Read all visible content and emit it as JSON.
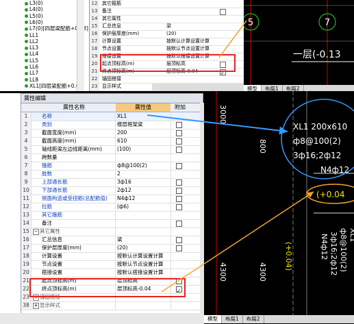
{
  "tree": {
    "items": [
      "L3(0)",
      "L4(0)",
      "L5(0)",
      "L6(0)",
      "L7(0)[四层梁配筋+0.08]",
      "LL1",
      "LL2",
      "LL3",
      "LL4",
      "LL5",
      "LL6",
      "LL7",
      "LL8",
      "XL1[四层梁配筋+0.04]"
    ]
  },
  "mini": {
    "rows": [
      {
        "num": "12",
        "name": "其它箍筋",
        "value": "",
        "check": false
      },
      {
        "num": "13",
        "name": "备注",
        "value": "",
        "check": false
      },
      {
        "num": "14",
        "name": "其它属性",
        "value": "",
        "check": false
      },
      {
        "num": "15",
        "name": "汇总信息",
        "value": "梁",
        "check": false
      },
      {
        "num": "16",
        "name": "保护层厚度(mm)",
        "value": "(20)",
        "check": false
      },
      {
        "num": "17",
        "name": "计算设置",
        "value": "按默认计算设置计算",
        "check": false
      },
      {
        "num": "18",
        "name": "节点设置",
        "value": "按默认节点设置计算",
        "check": false
      },
      {
        "num": "19",
        "name": "搭接设置",
        "value": "按默认搭接设置计算",
        "check": false
      },
      {
        "num": "20",
        "name": "起点顶标高(m)",
        "value": "层顶标高",
        "check": false
      },
      {
        "num": "21",
        "name": "终点顶标高(m)",
        "value": "层顶标高-0.04",
        "check": true
      },
      {
        "num": "22",
        "name": "锚固搭接",
        "value": "",
        "check": false
      },
      {
        "num": "23",
        "name": "显示样式",
        "value": "",
        "check": false
      }
    ]
  },
  "cad_top": {
    "axis_left": "5",
    "axis_right": "7",
    "floor_label": "一层(-0.13",
    "tabs": [
      "模型",
      "布局1",
      "布局2"
    ]
  },
  "editor": {
    "panel_title": "属性编辑",
    "col_name": "属性名称",
    "col_value": "属性值",
    "col_append": "附加",
    "rows": [
      {
        "num": "1",
        "name": "名称",
        "value": "XL1",
        "blue": true,
        "check": false,
        "sel": true
      },
      {
        "num": "2",
        "name": "类别",
        "value": "楼层框架梁",
        "blue": true,
        "check": true
      },
      {
        "num": "3",
        "name": "截面宽度(mm)",
        "value": "200",
        "blue": false,
        "check": true
      },
      {
        "num": "4",
        "name": "截面高度(mm)",
        "value": "610",
        "blue": false,
        "check": true
      },
      {
        "num": "5",
        "name": "轴线距梁左边线距离(mm)",
        "value": "(100)",
        "blue": false,
        "check": true
      },
      {
        "num": "6",
        "name": "跨数量",
        "value": "",
        "blue": false,
        "check": false
      },
      {
        "num": "7",
        "name": "箍筋",
        "value": "ф8@100(2)",
        "blue": true,
        "check": true
      },
      {
        "num": "8",
        "name": "肢数",
        "value": "2",
        "blue": true,
        "check": false
      },
      {
        "num": "9",
        "name": "上部通长筋",
        "value": "3ф16",
        "blue": true,
        "check": true
      },
      {
        "num": "10",
        "name": "下部通长筋",
        "value": "2ф12",
        "blue": true,
        "check": true
      },
      {
        "num": "11",
        "name": "侧面构造或受扭筋(总配筋值)",
        "value": "N4ф12",
        "blue": true,
        "check": true
      },
      {
        "num": "12",
        "name": "拉筋",
        "value": "(ф6)",
        "blue": true,
        "check": true
      },
      {
        "num": "13",
        "name": "其它箍筋",
        "value": "",
        "blue": true,
        "check": false
      },
      {
        "num": "14",
        "name": "备注",
        "value": "",
        "blue": false,
        "check": true
      },
      {
        "num": "15",
        "name": "其它属性",
        "value": "",
        "blue": false,
        "check": false,
        "section": true
      },
      {
        "num": "16",
        "name": "汇总信息",
        "value": "梁",
        "blue": false,
        "check": true
      },
      {
        "num": "17",
        "name": "保护层厚度(mm)",
        "value": "(20)",
        "blue": false,
        "check": true
      },
      {
        "num": "18",
        "name": "计算设置",
        "value": "按默认计算设置计算",
        "blue": false,
        "check": false
      },
      {
        "num": "19",
        "name": "节点设置",
        "value": "按默认节点设置计算",
        "blue": false,
        "check": false
      },
      {
        "num": "20",
        "name": "搭接设置",
        "value": "按默认搭接设置计算",
        "blue": false,
        "check": false
      },
      {
        "num": "21",
        "name": "起点顶标高(m)",
        "value": "层顶标高",
        "blue": false,
        "check": true
      },
      {
        "num": "22",
        "name": "终点顶标高(m)",
        "value": "层顶标高-0.04",
        "blue": false,
        "check": true,
        "checked": true
      },
      {
        "num": "23",
        "name": "锚固搭接",
        "value": "",
        "blue": false,
        "check": false,
        "section": true
      },
      {
        "num": "38",
        "name": "显示样式",
        "value": "",
        "blue": false,
        "check": false,
        "section": true
      }
    ]
  },
  "cad": {
    "dim_top": "3000",
    "dim_mid": "800",
    "dim_bottom_left": "4300",
    "dim_bottom_right": "4300",
    "annot_lines": [
      "XL1 200x610",
      "ф8@100(2)",
      "3ф16;2ф12",
      "N4ф12"
    ],
    "elevation": "(+0.04",
    "lower_annot": [
      "ф8@100(2)",
      "3ф16;2ф12",
      "N4ф12"
    ],
    "lower_elev": "(+0.04)",
    "lower_side": "XL1",
    "tabs": [
      "模型",
      "布局1",
      "布局2"
    ]
  },
  "colors": {
    "arrow_blue": "#3399ff",
    "arrow_orange": "#f5a623",
    "highlight_red": "#e62020",
    "cad_text": "#ffffff",
    "cad_yellow": "#f2e600"
  }
}
